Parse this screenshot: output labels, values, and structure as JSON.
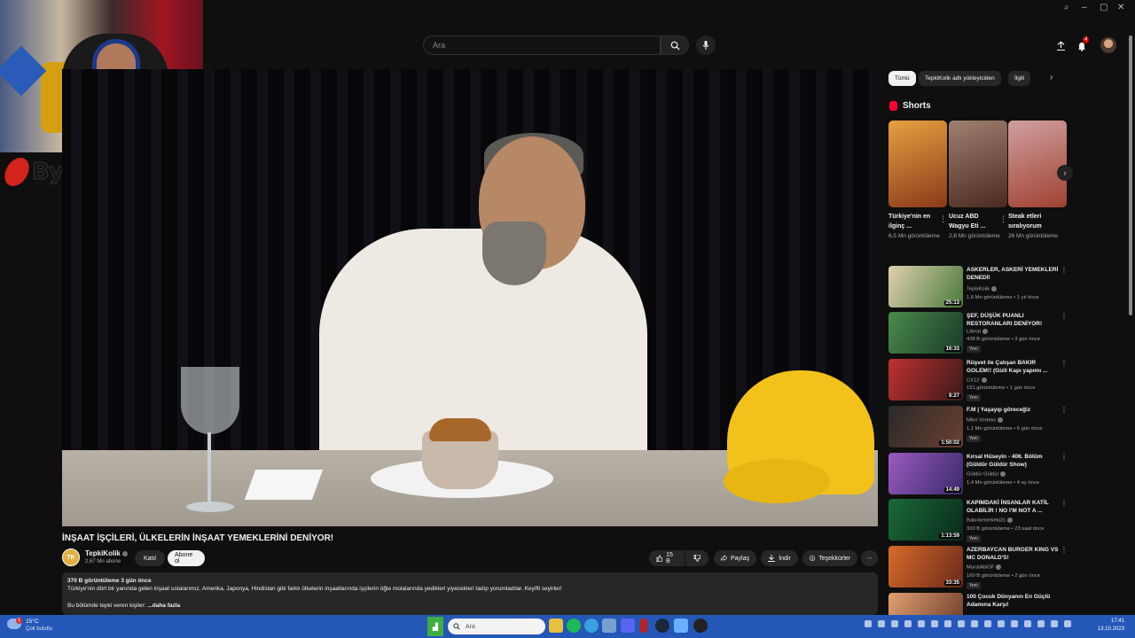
{
  "masthead": {
    "search_placeholder": "Ara",
    "notification_count": "4"
  },
  "overlay": {
    "channel_brand": "ByNoGame"
  },
  "video": {
    "title": "İNŞAAT İŞÇİLERİ, ÜLKELERİN İNŞAAT YEMEKLERİNİ DENİYOR!",
    "channel_avatar_text": "TK",
    "channel_name": "TepkiKolik",
    "subscribers": "2,67 Mn abone",
    "join_label": "Katıl",
    "subscribe_label": "Abone ol",
    "likes": "15 B",
    "share_label": "Paylaş",
    "download_label": "İndir",
    "thanks_label": "Teşekkürler",
    "description": {
      "stats": "370 B görüntüleme  3 gün önce",
      "text": "Türkiye'nin dört bir yanında gelen inşaat ustalarımız, Amerika, Japonya, Hindistan gibi farklı ülkelerin inşaatlarında işçilerin öğle molalarında yedikleri yiyecekleri tadıp yorumladılar. Keyifli seyirler!",
      "text2": "Bu bölümde tepki veren kişiler:",
      "more": "...daha fazla"
    }
  },
  "sidebar": {
    "chips": [
      "Tümü",
      "TepkiKolik adlı yükleyiciden",
      "İlgili"
    ],
    "shorts_heading": "Shorts",
    "shorts": [
      {
        "title": "Türkiye'nin en ilginç ...",
        "views": "6,5 Mn görüntüleme",
        "color": "#c96a2a"
      },
      {
        "title": "Ucuz ABD Wagyu Eti ...",
        "views": "2,8 Mn görüntüleme",
        "color": "#6a3a2a"
      },
      {
        "title": "Steak etleri sıralıyorum",
        "views": "26 Mn görüntüleme",
        "color": "#b84a4a"
      }
    ],
    "recommended": [
      {
        "title": "ASKERLER, ASKERİ YEMEKLERİ DENEDİ!",
        "channel": "TepkiKolik",
        "views": "1,6 Mn görüntüleme • 1 yıl önce",
        "duration": "25:13",
        "new": "",
        "color": "#5a8a4a"
      },
      {
        "title": "ŞEF, DÜŞÜK PUANLI RESTORANLARI DENİYOR!",
        "channel": "Literat",
        "views": "438 B görüntüleme • 3 gün önce",
        "duration": "16:33",
        "new": "Yeni",
        "color": "#3a5a3a"
      },
      {
        "title": "Rüşvet ile Çalışan BAKIR GOLEM!! (Gizli Kapı yapımı ...",
        "channel": "CX12",
        "views": "151 görüntüleme • 1 gün önce",
        "duration": "8:27",
        "new": "Yeni",
        "color": "#8a2a2a"
      },
      {
        "title": "F.M | Yaşayıp göreceğiz",
        "channel": "Mikrl Vorteks",
        "views": "1,1 Mn görüntüleme • 6 gün önce",
        "duration": "1:50:02",
        "new": "Yeni",
        "color": "#2a2a2a"
      },
      {
        "title": "Kırsal Hüseyin - 406. Bölüm (Güldür Güldür Show)",
        "channel": "Güldür Güldür",
        "views": "1,4 Mn görüntüleme • 4 ay önce",
        "duration": "14:49",
        "new": "",
        "color": "#7a4aa0"
      },
      {
        "title": "KAPIMDAKİ İNSANLAR KATİL OLABİLİR ! NO I'M NOT A ...",
        "channel": "Bakırkentekeki31",
        "views": "310 B görüntüleme • 23 saat önce",
        "duration": "1:13:59",
        "new": "Yeni",
        "color": "#1a4a2a"
      },
      {
        "title": "AZERBAYCAN BURGER KING VS MC DONALD'S!",
        "channel": "MuratAbiGF",
        "views": "160 B görüntüleme • 2 gün önce",
        "duration": "33:35",
        "new": "Yeni",
        "color": "#c84a2a"
      },
      {
        "title": "100 Çocuk Dünyanın En Güçlü Adamına Karşı!",
        "channel": "",
        "views": "",
        "duration": "",
        "new": "",
        "color": "#a05a3a"
      }
    ]
  },
  "taskbar": {
    "temperature": "15°C",
    "condition": "Çok bulutlu",
    "weather_badge": "1",
    "search_label": "Ara",
    "time": "17:41",
    "date": "13.10.2023"
  }
}
